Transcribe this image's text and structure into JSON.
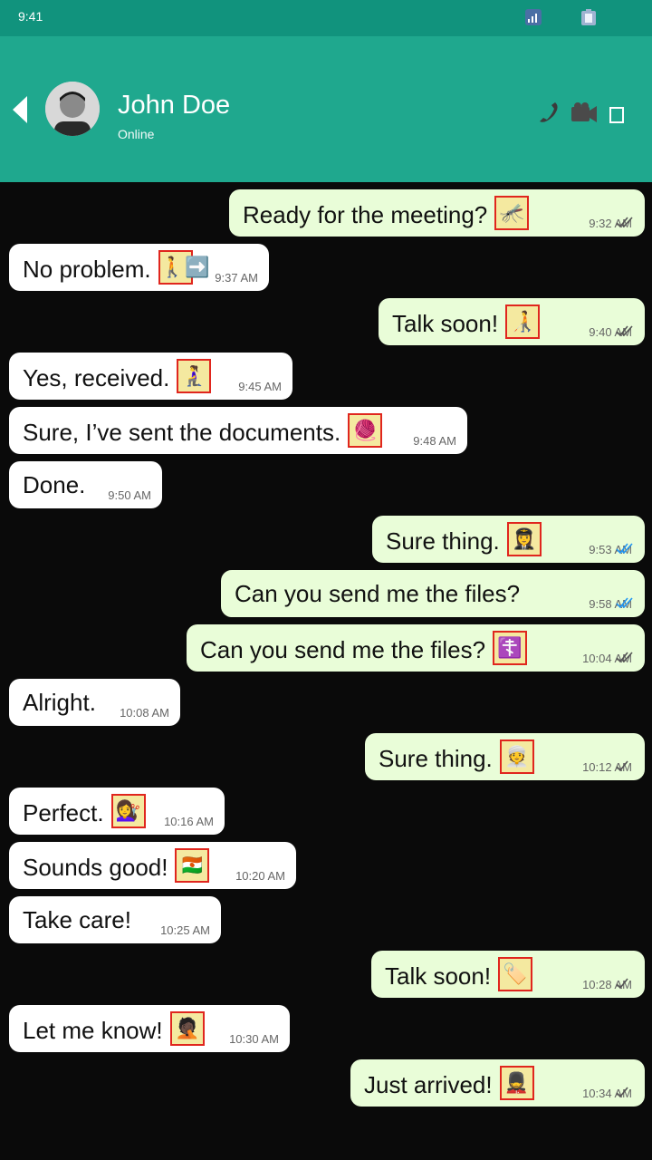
{
  "status_bar": {
    "time": "9:41"
  },
  "contact": {
    "name": "John Doe",
    "status": "Online"
  },
  "icons": {
    "back": "chevron-left-icon",
    "call": "phone-icon",
    "video": "video-camera-icon",
    "more": "more-icon"
  },
  "messages": [
    {
      "dir": "out",
      "text": "Ready for the meeting?",
      "emoji": "🦟",
      "time": "9:32 AM",
      "ticks": "read-gray"
    },
    {
      "dir": "in",
      "text": "No problem.",
      "emoji": "🚶➡️",
      "time": "9:37 AM"
    },
    {
      "dir": "out",
      "text": "Talk soon!",
      "emoji": "🧑‍🦯",
      "time": "9:40 AM",
      "ticks": "read-gray"
    },
    {
      "dir": "in",
      "text": "Yes, received.",
      "emoji": "🧎‍♀️",
      "time": "9:45 AM"
    },
    {
      "dir": "in",
      "text": "Sure, I’ve sent the documents.",
      "emoji": "🧶",
      "time": "9:48 AM"
    },
    {
      "dir": "in",
      "text": "Done.",
      "emoji": "",
      "time": "9:50 AM"
    },
    {
      "dir": "out",
      "text": "Sure thing.",
      "emoji": "👩‍✈️",
      "time": "9:53 AM",
      "ticks": "read-blue"
    },
    {
      "dir": "out",
      "text": "Can you send me the files?",
      "emoji": "",
      "time": "9:58 AM",
      "ticks": "read-blue"
    },
    {
      "dir": "out",
      "text": "Can you send me the files?",
      "emoji": "☦️",
      "time": "10:04 AM",
      "ticks": "read-gray"
    },
    {
      "dir": "in",
      "text": "Alright.",
      "emoji": "",
      "time": "10:08 AM"
    },
    {
      "dir": "out",
      "text": "Sure thing.",
      "emoji": "👳",
      "time": "10:12 AM",
      "ticks": "sent-gray"
    },
    {
      "dir": "in",
      "text": "Perfect.",
      "emoji": "💇‍♀️",
      "time": "10:16 AM"
    },
    {
      "dir": "in",
      "text": "Sounds good!",
      "emoji": "🇳🇪",
      "time": "10:20 AM"
    },
    {
      "dir": "in",
      "text": "Take care!",
      "emoji": "",
      "time": "10:25 AM"
    },
    {
      "dir": "out",
      "text": "Talk soon!",
      "emoji": "🏷️",
      "time": "10:28 AM",
      "ticks": "sent-gray"
    },
    {
      "dir": "in",
      "text": "Let me know!",
      "emoji": "🤦🏿",
      "time": "10:30 AM"
    },
    {
      "dir": "out",
      "text": "Just arrived!",
      "emoji": "💂",
      "time": "10:34 AM",
      "ticks": "sent-gray"
    }
  ]
}
